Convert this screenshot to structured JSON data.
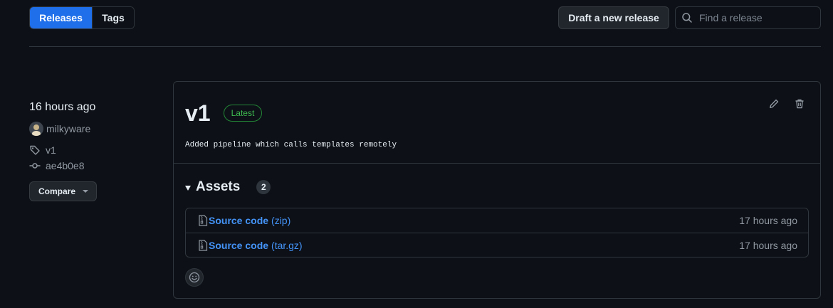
{
  "tabs": {
    "releases_label": "Releases",
    "tags_label": "Tags"
  },
  "toolbar": {
    "draft_label": "Draft a new release",
    "search_placeholder": "Find a release"
  },
  "release": {
    "time": "16 hours ago",
    "author": "milkyware",
    "tag": "v1",
    "commit": "ae4b0e8",
    "compare_label": "Compare",
    "title": "v1",
    "badge": "Latest",
    "notes": "Added pipeline which calls templates remotely",
    "assets_label": "Assets",
    "assets_count": "2",
    "assets": [
      {
        "name": "Source code",
        "ext": "(zip)",
        "time": "17 hours ago",
        "icon": "file-zip-icon"
      },
      {
        "name": "Source code",
        "ext": "(tar.gz)",
        "time": "17 hours ago",
        "icon": "file-zip-icon"
      }
    ]
  },
  "icons": {
    "search": "search-icon",
    "tag": "tag-icon",
    "commit": "git-commit-icon",
    "edit": "pencil-icon",
    "delete": "trash-icon",
    "reaction": "smiley-icon"
  },
  "colors": {
    "background": "#0d1117",
    "accent": "#1f6feb",
    "link": "#4493f8",
    "latest": "#3fb950",
    "border": "#30363d"
  }
}
